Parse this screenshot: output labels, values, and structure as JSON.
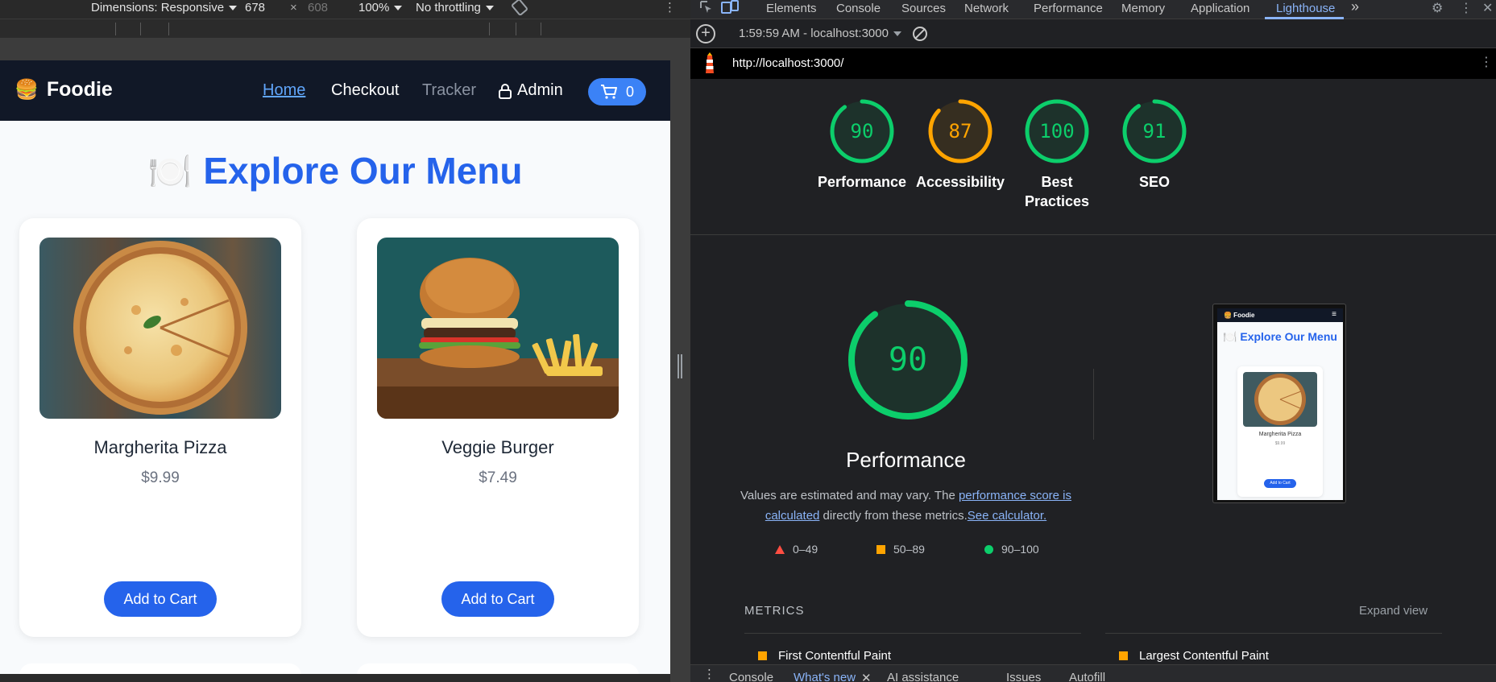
{
  "device_toolbar": {
    "dimensions": "Dimensions: Responsive",
    "width": "678",
    "times": "×",
    "height": "608",
    "zoom": "100%",
    "throttling": "No throttling"
  },
  "site": {
    "brand_emoji": "🍔",
    "brand": "Foodie",
    "nav": {
      "home": "Home",
      "checkout": "Checkout",
      "tracker": "Tracker",
      "admin": "Admin"
    },
    "cart_count": "0",
    "menu_title_emoji": "🍽️",
    "menu_title": "Explore Our Menu",
    "items": [
      {
        "name": "Margherita Pizza",
        "price": "$9.99",
        "button": "Add to Cart"
      },
      {
        "name": "Veggie Burger",
        "price": "$7.49",
        "button": "Add to Cart"
      }
    ]
  },
  "devtools": {
    "tabs": [
      "Elements",
      "Console",
      "Sources",
      "Network",
      "Performance",
      "Memory",
      "Application",
      "Lighthouse"
    ],
    "active_tab": "Lighthouse",
    "more_tabs": "»",
    "run_select": "1:59:59 AM - localhost:3000",
    "url": "http://localhost:3000/",
    "scores": [
      {
        "value": "90",
        "label": "Performance",
        "color": "#0cce6b"
      },
      {
        "value": "87",
        "label": "Accessibility",
        "color": "#ffa400"
      },
      {
        "value": "100",
        "label": "Best Practices",
        "color": "#0cce6b"
      },
      {
        "value": "91",
        "label": "SEO",
        "color": "#0cce6b"
      }
    ],
    "performance": {
      "score": "90",
      "title": "Performance",
      "desc_pre": "Values are estimated and may vary. The ",
      "desc_link1": "performance score is calculated",
      "desc_mid": " directly from these metrics.",
      "desc_link2": "See calculator.",
      "legend": [
        "0–49",
        "50–89",
        "90–100"
      ]
    },
    "thumbnail": {
      "brand": "🍔 Foodie",
      "menu_icon": "≡",
      "title": "🍽️ Explore Our Menu",
      "item_name": "Margherita Pizza",
      "item_price": "$9.99",
      "button": "Add to Cart"
    },
    "metrics": {
      "header": "METRICS",
      "expand": "Expand view",
      "items": [
        "First Contentful Paint",
        "Largest Contentful Paint"
      ]
    },
    "drawer": {
      "tabs": [
        "Console",
        "What's new",
        "AI assistance",
        "Issues",
        "Autofill"
      ]
    }
  },
  "colors": {
    "accent_blue": "#2563eb",
    "good": "#0cce6b",
    "average": "#ffa400",
    "fail": "#ff4e42"
  }
}
